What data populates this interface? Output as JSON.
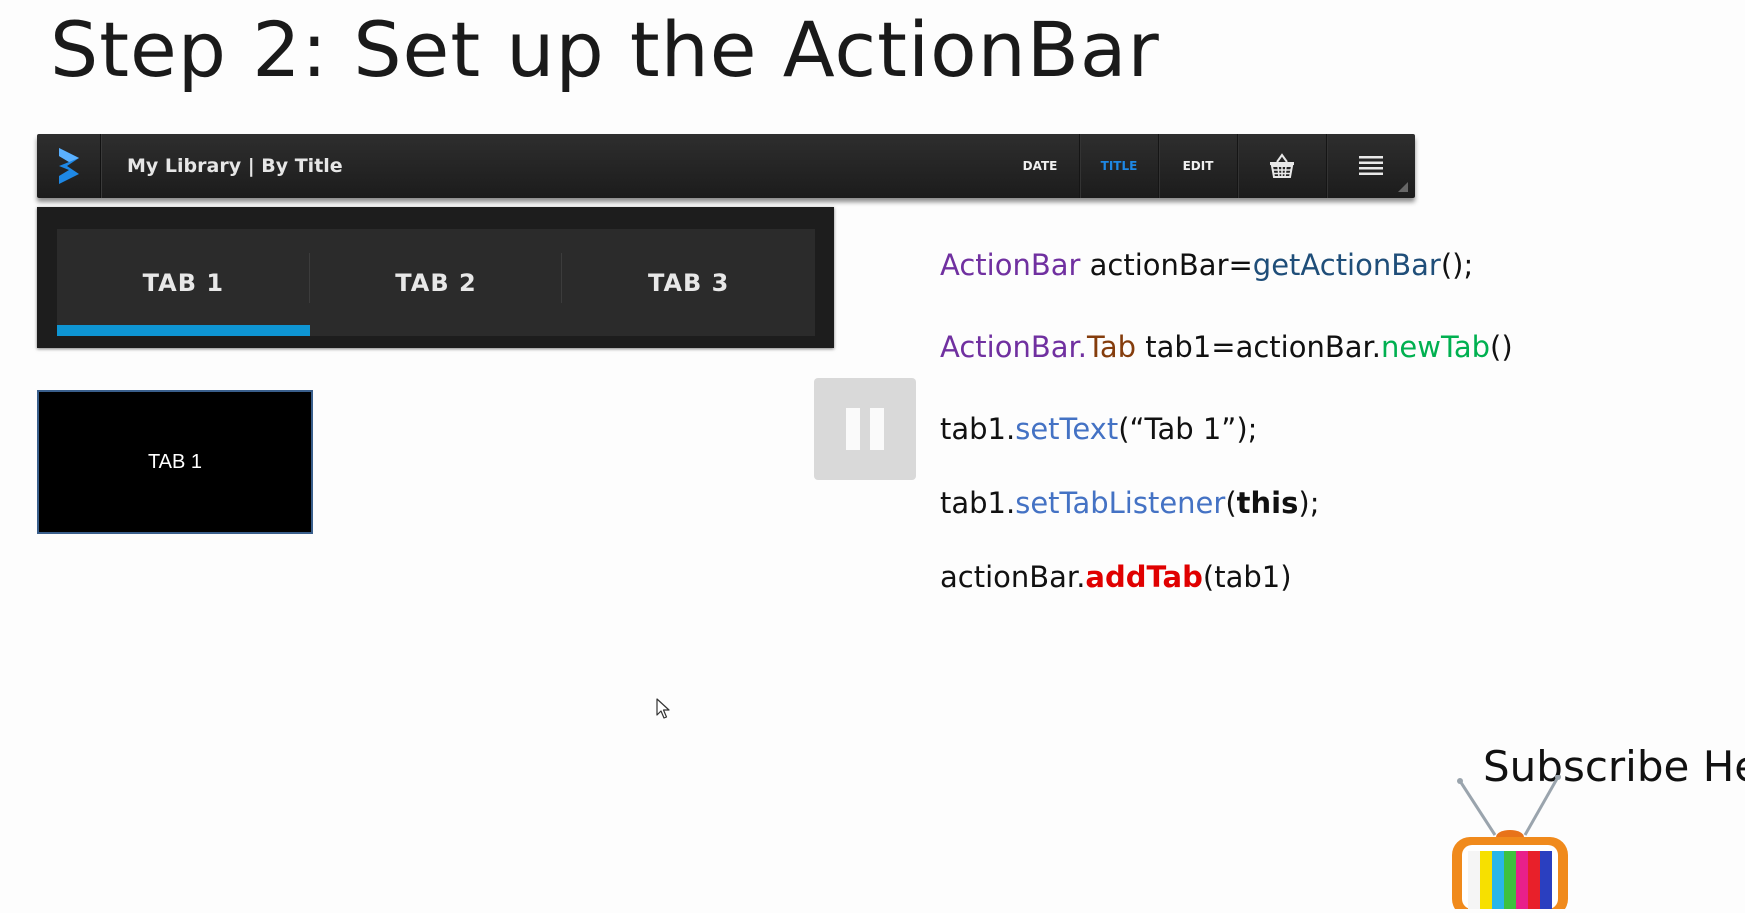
{
  "slide": {
    "title": "Step 2: Set up the ActionBar"
  },
  "actionbar": {
    "title": "My Library | By Title",
    "actions": [
      {
        "label": "DATE",
        "active": false
      },
      {
        "label": "TITLE",
        "active": true
      },
      {
        "label": "EDIT",
        "active": false
      }
    ],
    "icons": [
      "app-logo-icon",
      "basket-icon",
      "overflow-menu-icon"
    ],
    "accent_color": "#1e88e5"
  },
  "tabbar": {
    "tabs": [
      {
        "label": "TAB 1",
        "selected": true
      },
      {
        "label": "TAB 2",
        "selected": false
      },
      {
        "label": "TAB 3",
        "selected": false
      }
    ],
    "indicator_color": "#0e95d3"
  },
  "preview": {
    "label": "TAB 1"
  },
  "code": {
    "line1": {
      "p1": "ActionBar",
      "p2": " actionBar=",
      "p3": "getActionBar",
      "p4": "();"
    },
    "line2": {
      "p1": "ActionBar.",
      "p2": "Tab",
      "p3": " tab1=actionBar.",
      "p4": "newTab",
      "p5": "()"
    },
    "line3": {
      "p1": "tab1.",
      "p2": "setText",
      "p3": "(“Tab 1”);"
    },
    "line4": {
      "p1": "tab1.",
      "p2": "setTabListener",
      "p3": "(",
      "p4": "this",
      "p5": ");"
    },
    "line5": {
      "p1": "actionBar.",
      "p2": "addTab",
      "p3": "(tab1)"
    }
  },
  "subscribe": {
    "text": "Subscribe He"
  }
}
